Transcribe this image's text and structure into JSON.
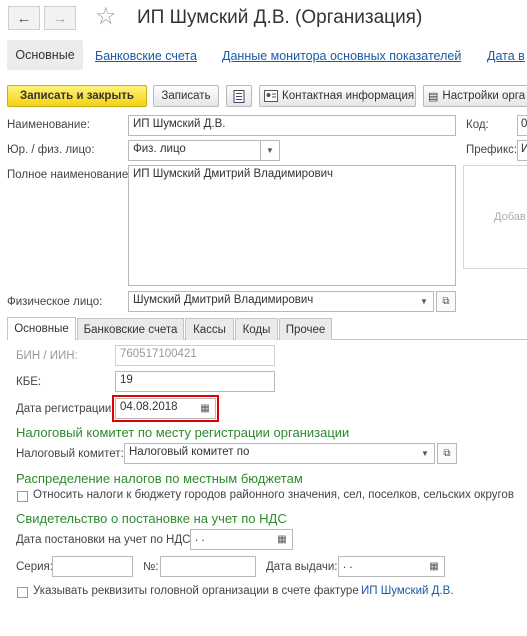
{
  "window": {
    "title": "ИП Шумский Д.В. (Организация)",
    "back_icon": "←",
    "forward_icon": "→",
    "star_icon": "☆"
  },
  "nav_tabs": [
    "Основные",
    "Банковские счета",
    "Данные монитора основных показателей",
    "Дата в"
  ],
  "toolbar": {
    "save_close": "Записать и закрыть",
    "save": "Записать",
    "contact_info": "Контактная информация",
    "settings": "Настройки орга"
  },
  "form": {
    "name_label": "Наименование:",
    "name_value": "ИП Шумский Д.В.",
    "code_label": "Код:",
    "code_value": "0",
    "legal_type_label": "Юр. / физ. лицо:",
    "legal_type_value": "Физ. лицо",
    "prefix_label": "Префикс:",
    "prefix_value": "И",
    "full_name_label": "Полное наименование:",
    "full_name_value": "ИП Шумский Дмитрий Владимирович",
    "add_logo": "Добав",
    "person_label": "Физическое лицо:",
    "person_value": "Шумский Дмитрий Владимирович"
  },
  "inner_tabs": [
    "Основные",
    "Банковские счета",
    "Кассы",
    "Коды",
    "Прочее"
  ],
  "main": {
    "bin_label": "БИН / ИИН:",
    "bin_value": "760517100421",
    "kbe_label": "КБЕ:",
    "kbe_value": "19",
    "reg_date_label": "Дата регистрации:",
    "reg_date_value": "04.08.2018",
    "tax_section": "Налоговый комитет по месту регистрации организации",
    "tax_label": "Налоговый комитет:",
    "tax_value": "Налоговый комитет по",
    "local_budget_section": "Распределение налогов по местным бюджетам",
    "local_budget_check": "Относить налоги к бюджету городов районного значения, сел, поселков, сельских округов",
    "vat_section": "Свидетельство о постановке на учет по НДС",
    "vat_date_label": "Дата постановки на учет по НДС:",
    "vat_date_value": " .  .",
    "series_label": "Серия:",
    "number_label": "№:",
    "issue_date_label": "Дата выдачи:",
    "issue_date_value": " .  .",
    "head_org_check": "Указывать реквизиты головной организации в счете фактуре",
    "head_org_link": "ИП Шумский Д.В."
  },
  "colors": {
    "highlight_border": "#e00000",
    "section_green": "#2e8b2e",
    "link_blue": "#1a5aa8",
    "primary_button": "#f3d312"
  }
}
